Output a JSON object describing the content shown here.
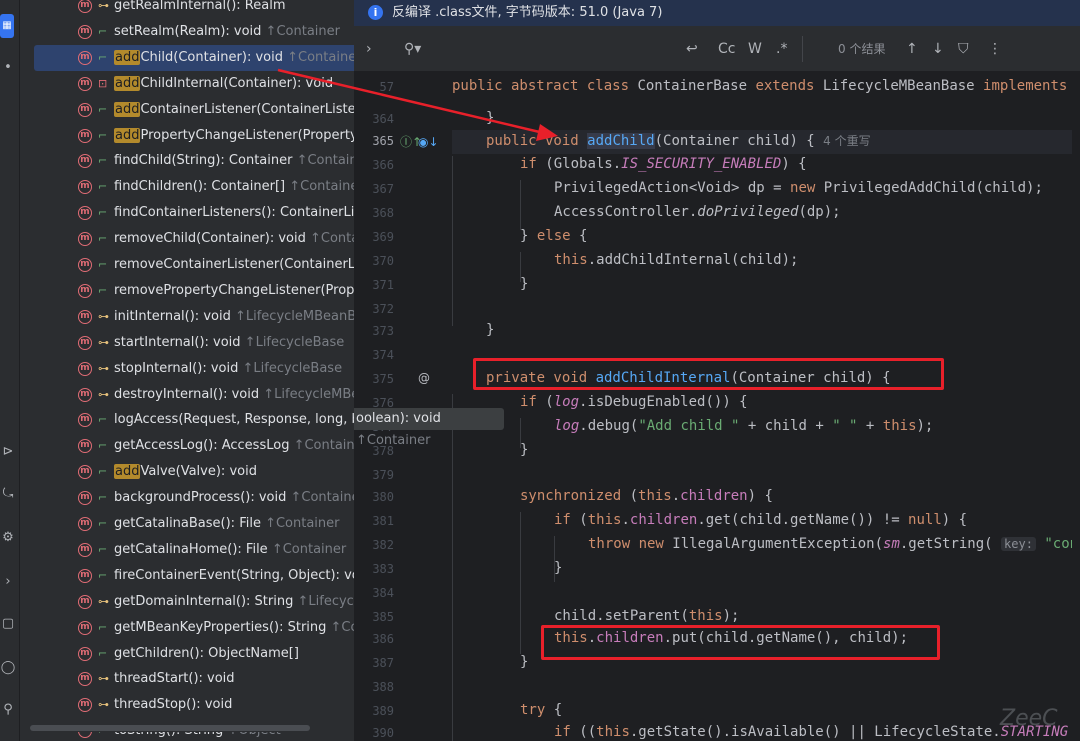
{
  "notification": {
    "text": "反编译 .class文件, 字节码版本: 51.0 (Java 7)"
  },
  "search": {
    "results_label": "0 个结果",
    "case_label": "Cc",
    "word_label": "W",
    "regex_label": ".*"
  },
  "structure": {
    "items": [
      {
        "name": "getRealmInternal(): Realm",
        "inherited": "",
        "vis": "prot",
        "prefix": "",
        "hl": ""
      },
      {
        "name": "setRealm(Realm): void",
        "inherited": "↑Container",
        "vis": "pub",
        "prefix": "",
        "hl": ""
      },
      {
        "name": "Child(Container): void",
        "inherited": "↑Container",
        "vis": "pub",
        "prefix": "",
        "hl": "add",
        "selected": true
      },
      {
        "name": "ChildInternal(Container): void",
        "inherited": "",
        "vis": "priv",
        "prefix": "",
        "hl": "add"
      },
      {
        "name": "ContainerListener(ContainerListene",
        "inherited": "",
        "vis": "pub",
        "prefix": "",
        "hl": "add"
      },
      {
        "name": "PropertyChangeListener(PropertyC",
        "inherited": "",
        "vis": "pub",
        "prefix": "",
        "hl": "add"
      },
      {
        "name": "findChild(String): Container",
        "inherited": "↑Container",
        "vis": "pub",
        "prefix": "",
        "hl": ""
      },
      {
        "name": "findChildren(): Container[]",
        "inherited": "↑Container",
        "vis": "pub",
        "prefix": "",
        "hl": ""
      },
      {
        "name": "findContainerListeners(): ContainerListe",
        "inherited": "",
        "vis": "pub",
        "prefix": "",
        "hl": ""
      },
      {
        "name": "removeChild(Container): void",
        "inherited": "↑Contain",
        "vis": "pub",
        "prefix": "",
        "hl": ""
      },
      {
        "name": "removeContainerListener(ContainerLis",
        "inherited": "",
        "vis": "pub",
        "prefix": "",
        "hl": ""
      },
      {
        "name": "removePropertyChangeListener(Prope",
        "inherited": "",
        "vis": "pub",
        "prefix": "",
        "hl": ""
      },
      {
        "name": "initInternal(): void",
        "inherited": "↑LifecycleMBeanBas",
        "vis": "prot",
        "prefix": "",
        "hl": ""
      },
      {
        "name": "startInternal(): void",
        "inherited": "↑LifecycleBase",
        "vis": "prot",
        "prefix": "",
        "hl": ""
      },
      {
        "name": "stopInternal(): void",
        "inherited": "↑LifecycleBase",
        "vis": "prot",
        "prefix": "",
        "hl": ""
      },
      {
        "name": "destroyInternal(): void",
        "inherited": "↑LifecycleMBean",
        "vis": "prot",
        "prefix": "",
        "hl": ""
      },
      {
        "name": "logAccess(Request, Response, long, boolean): void",
        "inherited": "↑Container",
        "vis": "pub",
        "prefix": "",
        "hl": ""
      },
      {
        "name": "getAccessLog(): AccessLog",
        "inherited": "↑Container",
        "vis": "pub",
        "prefix": "",
        "hl": ""
      },
      {
        "name": "Valve(Valve): void",
        "inherited": "",
        "vis": "pub",
        "prefix": "",
        "hl": "add"
      },
      {
        "name": "backgroundProcess(): void",
        "inherited": "↑Container",
        "vis": "pub",
        "prefix": "",
        "hl": ""
      },
      {
        "name": "getCatalinaBase(): File",
        "inherited": "↑Container",
        "vis": "pub",
        "prefix": "",
        "hl": ""
      },
      {
        "name": "getCatalinaHome(): File",
        "inherited": "↑Container",
        "vis": "pub",
        "prefix": "",
        "hl": ""
      },
      {
        "name": "fireContainerEvent(String, Object): voic",
        "inherited": "",
        "vis": "pub",
        "prefix": "",
        "hl": ""
      },
      {
        "name": "getDomainInternal(): String",
        "inherited": "↑LifecycleM",
        "vis": "prot",
        "prefix": "",
        "hl": ""
      },
      {
        "name": "getMBeanKeyProperties(): String",
        "inherited": "↑Con",
        "vis": "pub",
        "prefix": "",
        "hl": ""
      },
      {
        "name": "getChildren(): ObjectName[]",
        "inherited": "",
        "vis": "pub",
        "prefix": "",
        "hl": ""
      },
      {
        "name": "threadStart(): void",
        "inherited": "",
        "vis": "prot",
        "prefix": "",
        "hl": ""
      },
      {
        "name": "threadStop(): void",
        "inherited": "",
        "vis": "prot",
        "prefix": "",
        "hl": ""
      },
      {
        "name": "toString(): String",
        "inherited": "↑Object",
        "vis": "pub",
        "prefix": "",
        "hl": ""
      }
    ]
  },
  "editor": {
    "line_numbers": [
      "57",
      "364",
      "365",
      "366",
      "367",
      "368",
      "369",
      "370",
      "371",
      "372",
      "373",
      "374",
      "375",
      "376",
      "377",
      "378",
      "379",
      "380",
      "381",
      "382",
      "383",
      "384",
      "385",
      "386",
      "387",
      "388",
      "389",
      "390"
    ],
    "overrides_hint": "4 个重写",
    "key_hint": "key:",
    "lines": {
      "l57": "public abstract class ContainerBase extends LifecycleMBeanBase implements",
      "l365a": "public void ",
      "l365b": "addChild",
      "l365c": "(Container child) {",
      "l366": "if (Globals.IS_SECURITY_ENABLED) {",
      "l367": "PrivilegedAction<Void> dp = new PrivilegedAddChild(child);",
      "l368": "AccessController.doPrivileged(dp);",
      "l369": "} else {",
      "l370": "this.addChildInternal(child);",
      "l371": "}",
      "l373": "}",
      "l375": "private void addChildInternal(Container child) {",
      "l376": "if (log.isDebugEnabled()) {",
      "l377": "log.debug(\"Add child \" + child + \" \" + this);",
      "l378": "}",
      "l380": "synchronized (this.children) {",
      "l381": "if (this.children.get(child.getName()) != null) {",
      "l382": "throw new IllegalArgumentException(sm.getString(",
      "l382b": "\"cont",
      "l383": "}",
      "l385": "child.setParent(this);",
      "l386": "this.children.put(child.getName(), child);",
      "l387": "}",
      "l389": "try {",
      "l390": "if ((this.getState().isAvailable() || LifecycleState.STARTING"
    }
  },
  "watermark": "ZeeC"
}
